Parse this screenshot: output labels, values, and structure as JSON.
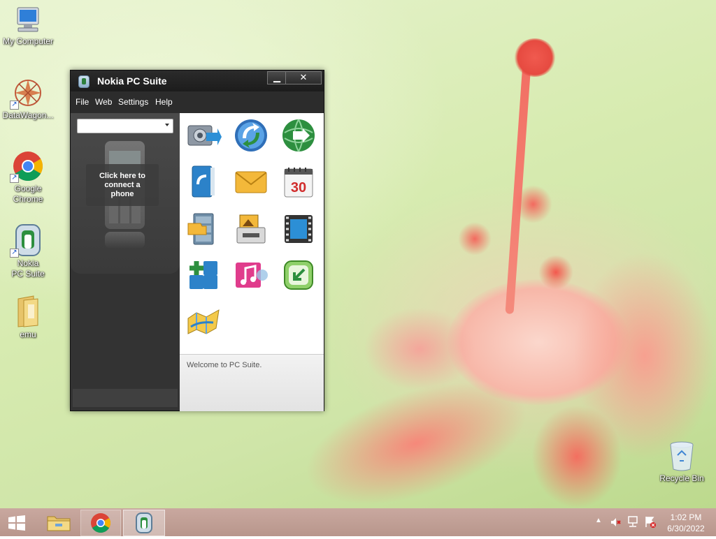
{
  "desktop": {
    "icons": [
      {
        "label": "My Computer",
        "icon": "computer-icon"
      },
      {
        "label": "DataWagon...",
        "icon": "datawagon-icon"
      },
      {
        "label": "Google Chrome",
        "icon": "chrome-icon"
      },
      {
        "label": "Nokia PC Suite",
        "icon": "nokia-pc-suite-icon"
      },
      {
        "label": "emu",
        "icon": "folder-icon"
      },
      {
        "label": "Recycle Bin",
        "icon": "recycle-bin-icon"
      }
    ]
  },
  "window": {
    "title": "Nokia PC Suite",
    "menu": [
      "File",
      "Web",
      "Settings",
      "Help"
    ],
    "phone_select_value": "",
    "connect_text": "Click here to connect a phone",
    "status": "Welcome to PC Suite.",
    "apps": [
      "backup-icon",
      "sync-icon",
      "web-connect-icon",
      "contacts-icon",
      "messages-icon",
      "calendar-icon",
      "file-manager-icon",
      "image-store-icon",
      "video-manager-icon",
      "install-apps-icon",
      "music-manager-icon",
      "update-icon",
      "maps-icon"
    ],
    "calendar_day": "30"
  },
  "taskbar": {
    "time": "1:02 PM",
    "date": "6/30/2022"
  },
  "colors": {
    "window_bg": "#2c2c2c",
    "taskbar": "#c0a096",
    "accent_green": "#2d8f3f"
  }
}
